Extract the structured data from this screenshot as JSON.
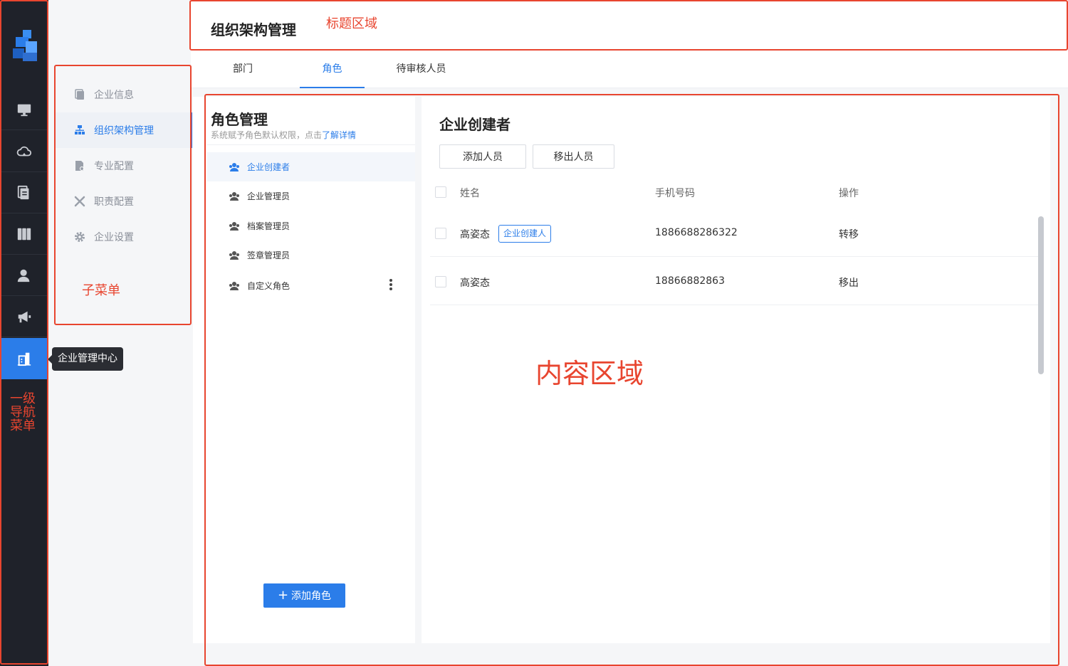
{
  "colors": {
    "accent": "#2b7de9",
    "annotation": "#e8452f",
    "nav_bg": "#1f222a"
  },
  "nav": {
    "items": [
      {
        "icon": "monitor-icon"
      },
      {
        "icon": "cloud-icon"
      },
      {
        "icon": "document-icon"
      },
      {
        "icon": "books-icon"
      },
      {
        "icon": "user-icon"
      },
      {
        "icon": "megaphone-icon"
      },
      {
        "icon": "building-icon",
        "active": true
      }
    ],
    "tooltip": "企业管理中心"
  },
  "submenu": {
    "items": [
      {
        "label": "企业信息",
        "icon": "document-icon"
      },
      {
        "label": "组织架构管理",
        "icon": "org-chart-icon",
        "active": true
      },
      {
        "label": "专业配置",
        "icon": "file-gear-icon"
      },
      {
        "label": "职责配置",
        "icon": "tools-icon"
      },
      {
        "label": "企业设置",
        "icon": "gear-icon"
      }
    ]
  },
  "header": {
    "title": "组织架构管理"
  },
  "tabs": [
    {
      "label": "部门"
    },
    {
      "label": "角色",
      "active": true
    },
    {
      "label": "待审核人员"
    }
  ],
  "roles": {
    "title": "角色管理",
    "desc": "系统赋予角色默认权限，点击",
    "desc_link": "了解详情",
    "items": [
      {
        "label": "企业创建者",
        "active": true
      },
      {
        "label": "企业管理员"
      },
      {
        "label": "档案管理员"
      },
      {
        "label": "签章管理员"
      },
      {
        "label": "自定义角色"
      }
    ],
    "add_button": "添加角色",
    "add_icon": "+"
  },
  "detail": {
    "title": "企业创建者",
    "add_member": "添加人员",
    "remove_member": "移出人员",
    "columns": {
      "name": "姓名",
      "phone": "手机号码",
      "action": "操作"
    },
    "rows": [
      {
        "name": "高姿态",
        "tag": "企业创建人",
        "phone": "1886688286322",
        "action": "转移"
      },
      {
        "name": "高姿态",
        "phone": "18866882863",
        "action": "移出"
      }
    ]
  },
  "annotations": {
    "title_area": "标题区域",
    "submenu": "子菜单",
    "primary_nav": "一级\n导航\n菜单",
    "content_area": "内容区域"
  }
}
